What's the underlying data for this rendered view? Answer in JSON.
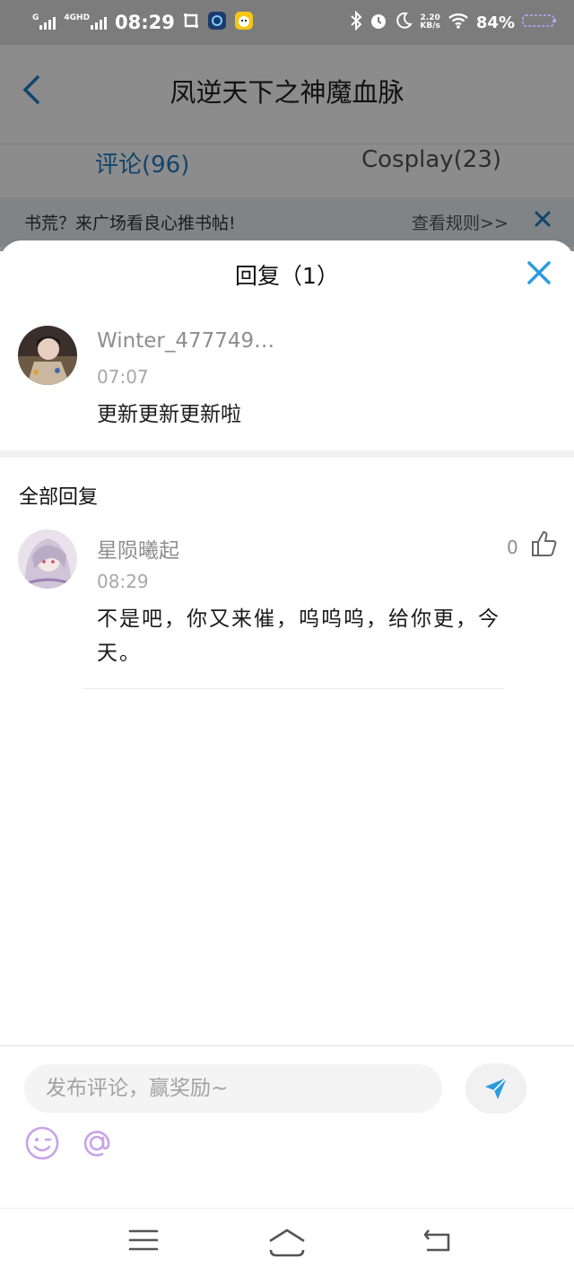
{
  "status_bar": {
    "time": "08:29",
    "network_1": "G",
    "network_2": "4GHD",
    "speed_value": "2.20",
    "speed_unit": "KB/s",
    "battery": "84%",
    "icons": [
      "signal-icon",
      "signal-icon",
      "screenshot-icon",
      "app-notification-icon",
      "app-notification-icon",
      "bluetooth-icon",
      "alarm-icon",
      "do-not-disturb-icon",
      "wifi-icon",
      "battery-icon"
    ]
  },
  "header": {
    "title": "凤逆天下之神魔血脉",
    "tabs": [
      {
        "label": "评论(96)",
        "active": true
      },
      {
        "label": "Cosplay(23)",
        "active": false
      }
    ]
  },
  "banner": {
    "text": "书荒？来广场看良心推书帖!",
    "link": "查看规则>>"
  },
  "sheet": {
    "title": "回复（1）",
    "original_comment": {
      "username": "Winter_477749…",
      "time": "07:07",
      "content": "更新更新更新啦"
    },
    "section_label": "全部回复",
    "replies": [
      {
        "username": "星陨曦起",
        "time": "08:29",
        "content": "不是吧，你又来催，呜呜呜，给你更，今天。",
        "likes": "0"
      }
    ]
  },
  "composer": {
    "placeholder": "发布评论，赢奖励~"
  },
  "colors": {
    "accent": "#1f7ec4",
    "close_icon": "#2a9be0",
    "emoji_icon": "#c8a2e8"
  }
}
